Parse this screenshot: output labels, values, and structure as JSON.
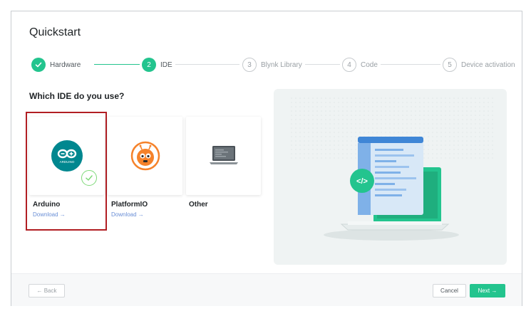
{
  "dialog": {
    "title": "Quickstart"
  },
  "stepper": {
    "steps": [
      {
        "number": "",
        "label": "Hardware",
        "state": "done"
      },
      {
        "number": "2",
        "label": "IDE",
        "state": "active"
      },
      {
        "number": "3",
        "label": "Blynk Library",
        "state": "todo"
      },
      {
        "number": "4",
        "label": "Code",
        "state": "todo"
      },
      {
        "number": "5",
        "label": "Device activation",
        "state": "todo"
      }
    ]
  },
  "question": "Which IDE do you use?",
  "ides": [
    {
      "name": "Arduino",
      "link": "Download →",
      "logo_text": "ARDUINO",
      "selected": true
    },
    {
      "name": "PlatformIO",
      "link": "Download →",
      "selected": false
    },
    {
      "name": "Other",
      "link": "",
      "selected": false
    }
  ],
  "illustration": {
    "code_badge": "</>"
  },
  "footer": {
    "back_label": "← Back",
    "cancel_label": "Cancel",
    "next_label": "Next →"
  },
  "colors": {
    "accent": "#23c48e",
    "arduino": "#00878f",
    "platformio": "#f5822a",
    "selection": "#b11e23",
    "link": "#6a8fd6"
  }
}
